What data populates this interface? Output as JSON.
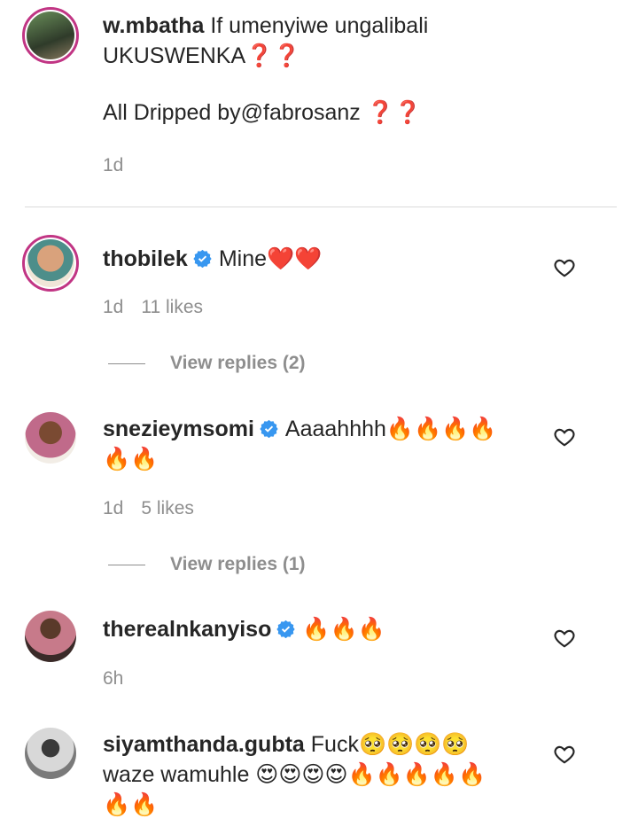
{
  "caption": {
    "username": "w.mbatha",
    "line1": "If umenyiwe ungalibali",
    "line2": "UKUSWENKA❓❓",
    "line3": "All Dripped by@fabrosanz ❓❓",
    "time": "1d"
  },
  "comments": [
    {
      "username": "thobilek",
      "text": "Mine❤️❤️",
      "time": "1d",
      "likes": "11 likes",
      "replies": "View replies (2)"
    },
    {
      "username": "snezieymsomi",
      "text": "Aaaahhhh🔥🔥🔥🔥",
      "text2": "🔥🔥",
      "time": "1d",
      "likes": "5 likes",
      "replies": "View replies (1)"
    },
    {
      "username": "therealnkanyiso",
      "text": "🔥🔥🔥",
      "time": "6h"
    },
    {
      "username": "siyamthanda.gubta",
      "text": "Fuck🥺🥺🥺🥺",
      "text2": "waze wamuhle 😍😍😍😍🔥🔥🔥🔥🔥",
      "text3": "🔥🔥"
    }
  ],
  "colors": {
    "verified": "#3897f0",
    "ring": "#c13584",
    "muted": "#8e8e8e"
  }
}
